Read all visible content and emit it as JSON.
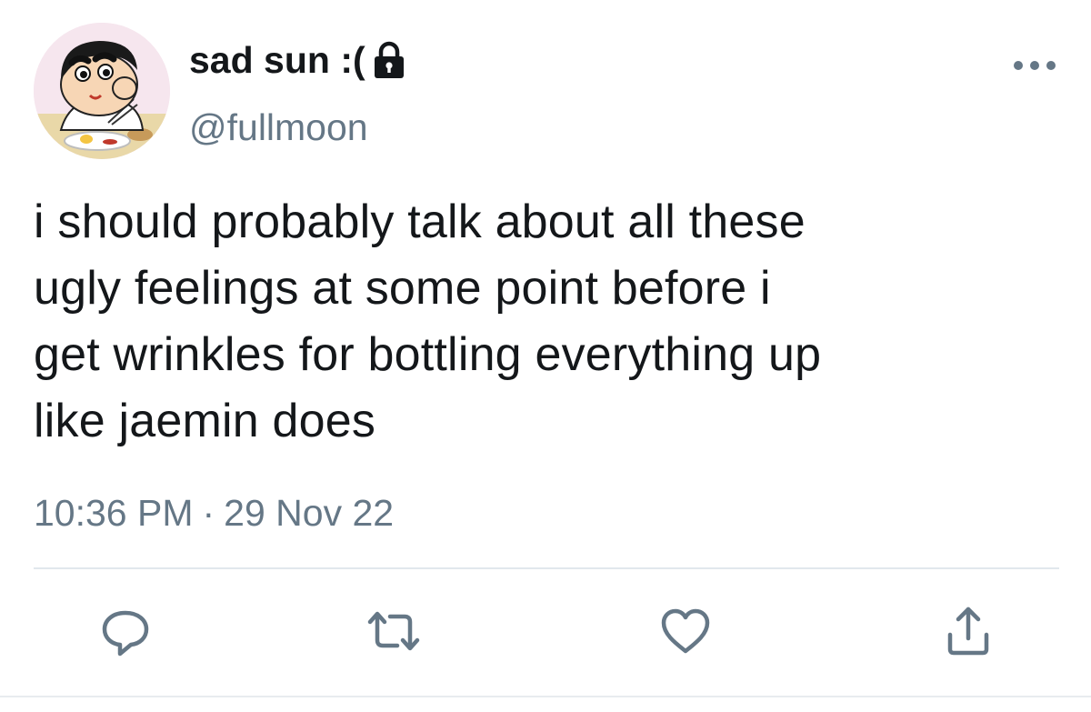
{
  "user": {
    "display_name": "sad sun :(",
    "handle": "@fullmoon",
    "avatar_icon": "cartoon-boy-avatar",
    "protected_icon": "lock-icon"
  },
  "tweet": {
    "text": "i should probably talk about all these\nugly feelings at some point before i\nget wrinkles for bottling everything up\nlike jaemin does",
    "time": "10:36 PM",
    "separator": "·",
    "date": "29 Nov 22"
  },
  "actions": [
    {
      "name": "reply",
      "icon": "reply-icon"
    },
    {
      "name": "retweet",
      "icon": "retweet-icon"
    },
    {
      "name": "like",
      "icon": "heart-icon"
    },
    {
      "name": "share",
      "icon": "share-icon"
    }
  ],
  "more_icon": "more-options-icon",
  "colors": {
    "text": "#14171a",
    "secondary": "#657786",
    "divider": "#e1e8ed"
  }
}
